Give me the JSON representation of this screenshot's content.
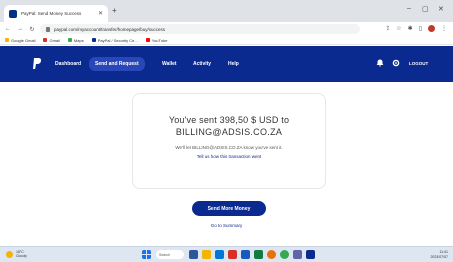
{
  "browser": {
    "tab_title": "PayPal: Send Money Success",
    "url": "paypal.com/myaccount/transfer/homepage/buy/success",
    "bookmarks": [
      "Google Gmail",
      "Gmail",
      "Maps",
      "PayPal / Security Ce...",
      "YouTube"
    ]
  },
  "paypal": {
    "nav": [
      "Dashboard",
      "Send and Request",
      "Wallet",
      "Activity",
      "Help"
    ],
    "user_name": "LOGOUT"
  },
  "confirmation": {
    "sent_line": "You've sent 398,50 $ USD to",
    "recipient": "BILLING@ADSIS.CO.ZA",
    "let_know": "We'll let BILLING@ADSIS.CO.ZA know you've sent it.",
    "tell_us": "Tell us how this transaction went"
  },
  "actions": {
    "send_more": "Send More Money",
    "go_summary": "Go to Summary"
  },
  "taskbar": {
    "weather_temp": "18°C",
    "weather_desc": "Cloudy",
    "search": "Search",
    "time": "11:41",
    "date": "2023/07/07"
  },
  "colors": {
    "paypal_navy": "#0b2a8f",
    "link_blue": "#0b2a8f"
  }
}
